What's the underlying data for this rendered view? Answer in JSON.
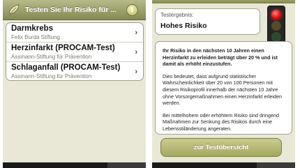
{
  "left": {
    "nav": {
      "title": "Testen Sie Ihr Risiko für ...",
      "logo_icon": "leaf-logo-icon",
      "info_label": "i"
    },
    "tests": [
      {
        "title": "Darmkrebs",
        "subtitle": "Felix Burda Stiftung"
      },
      {
        "title": "Herzinfarkt (PROCAM-Test)",
        "subtitle": "Assmann-Stiftung für Prävention"
      },
      {
        "title": "Schlaganfall (PROCAM-Test)",
        "subtitle": "Assmann-Stiftung für Prävention"
      }
    ],
    "chevron": "›"
  },
  "right": {
    "result": {
      "caption": "Testergebnis:",
      "value": "Hohes Risiko"
    },
    "traffic_light": {
      "active": "red",
      "colors": {
        "red": "#e01010",
        "amber": "#554a2a",
        "green": "#2e4a2e"
      }
    },
    "paragraphs": [
      "Ihr Risiko in den nächsten 10 Jahren einen Herzinfarkt zu erleiden beträgt über 20 % und ist damit als erhöht einzustufen.",
      "Dies bedeutet, dass aufgrund statistischer Wahrscheinlichkeit über 20 von 100 Personen mit diesem Risikoprofil innerhalb der nächsten 10 Jahre ohne Vorsorgemaßnahmen einen Herzinfarkt erleiden werden.",
      "Bei mittelhohem oder erhöhtem Risiko sind dringend Maßnahmen zur Senkung des Risikos durch eine Lebensstiländerung angeraten."
    ],
    "button_label": "zur Testübersicht"
  },
  "colors": {
    "accent": "#9aa066",
    "background": "#e9e8d7"
  }
}
